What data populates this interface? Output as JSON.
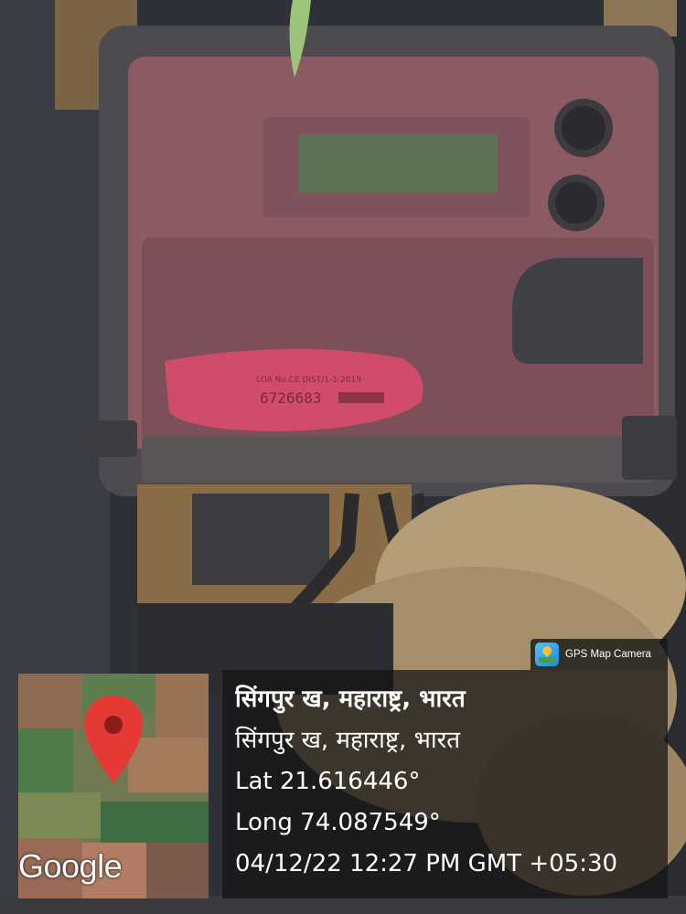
{
  "overlay": {
    "app_name": "GPS Map Camera",
    "map_attribution": "Google",
    "location_title": "सिंगपुर ख, महाराष्ट्र, भारत",
    "address_line": "सिंगपुर ख, महाराष्ट्र, भारत",
    "latitude": "Lat 21.616446°",
    "longitude": "Long 74.087549°",
    "timestamp": "04/12/22 12:27 PM GMT +05:30"
  },
  "meter": {
    "label_line1": "LOA No.CE DIST/1-1-2019",
    "serial_number": "6726683"
  },
  "colors": {
    "meter_body": "#8b5a63",
    "meter_label": "#d14c6a",
    "overlay_panel": "#141414",
    "map_pin": "#e53935",
    "enclosure": "#2f3138",
    "straw": "#b59d78"
  }
}
